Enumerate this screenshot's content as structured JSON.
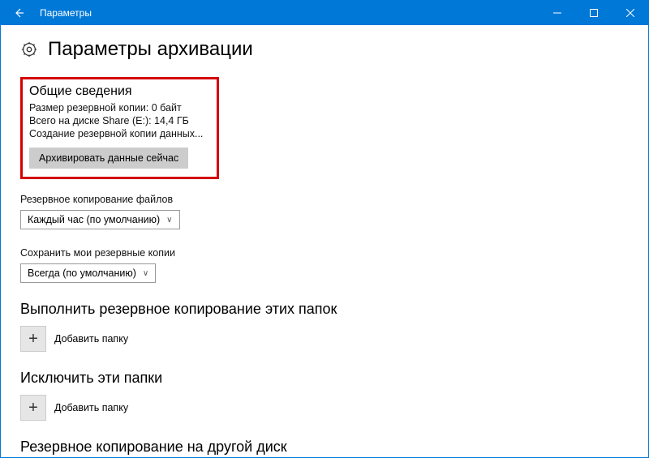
{
  "window": {
    "title": "Параметры"
  },
  "page": {
    "title": "Параметры архивации"
  },
  "overview": {
    "heading": "Общие сведения",
    "backup_size": "Размер резервной копии: 0 байт",
    "disk_total": "Всего на диске Share (E:): 14,4 ГБ",
    "creating": "Создание резервной копии данных...",
    "button": "Архивировать данные сейчас"
  },
  "backup_files": {
    "label": "Резервное копирование файлов",
    "value": "Каждый час (по умолчанию)"
  },
  "keep_backups": {
    "label": "Сохранить мои резервные копии",
    "value": "Всегда (по умолчанию)"
  },
  "folders_include": {
    "heading": "Выполнить резервное копирование этих папок",
    "add": "Добавить папку"
  },
  "folders_exclude": {
    "heading": "Исключить эти папки",
    "add": "Добавить папку"
  },
  "other_disk": {
    "heading": "Резервное копирование на другой диск"
  }
}
